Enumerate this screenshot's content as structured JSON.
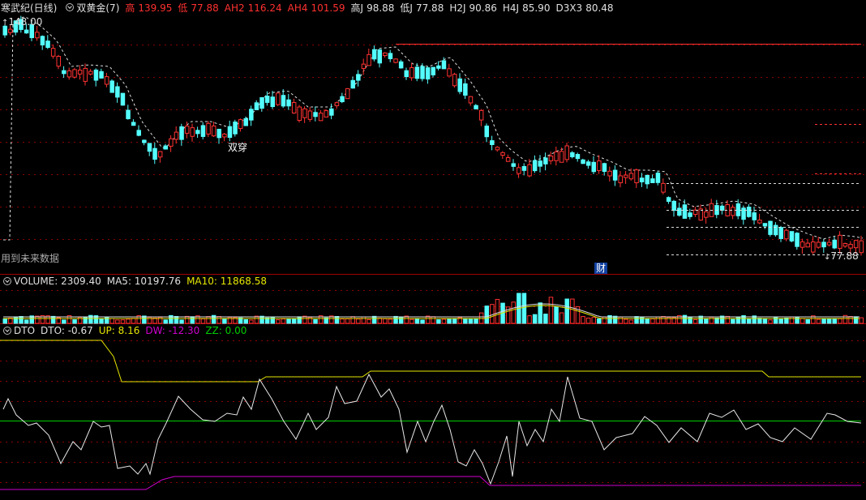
{
  "main": {
    "stock_name": "寒武纪(日线)",
    "indicator": "双黄金(7)",
    "readouts": [
      {
        "label": "高",
        "value": "139.95",
        "color": "#ff3030"
      },
      {
        "label": "低",
        "value": "77.88",
        "color": "#ff3030"
      },
      {
        "label": "AH2",
        "value": "116.24",
        "color": "#ff3030"
      },
      {
        "label": "AH4",
        "value": "101.59",
        "color": "#ff3030"
      },
      {
        "label": "高J",
        "value": "98.88",
        "color": "#e0e0e0"
      },
      {
        "label": "低J",
        "value": "77.88",
        "color": "#e0e0e0"
      },
      {
        "label": "H2J",
        "value": "90.86",
        "color": "#e0e0e0"
      },
      {
        "label": "H4J",
        "value": "85.90",
        "color": "#e0e0e0"
      },
      {
        "label": "D3X3",
        "value": "80.48",
        "color": "#e0e0e0"
      }
    ],
    "high_marker": "148.00",
    "low_marker": "77.88",
    "cross_label": "双穿",
    "future_label": "用到未来数据",
    "earnings_badge": "财"
  },
  "volume": {
    "name": "VOLUME",
    "value": "2309.40",
    "ma5_label": "MA5",
    "ma5_value": "10197.76",
    "ma10_label": "MA10",
    "ma10_value": "11868.58"
  },
  "dto": {
    "name": "DTO",
    "dto_label": "DTO",
    "dto_value": "-0.67",
    "up_label": "UP",
    "up_value": "8.16",
    "dw_label": "DW",
    "dw_value": "-12.30",
    "zz_label": "ZZ",
    "zz_value": "0.00"
  },
  "colors": {
    "up": "#ff3232",
    "down": "#54ffff",
    "ma_white": "#e8e8e8",
    "ma_yellow": "#e6e600",
    "ma_magenta": "#d000d0",
    "zz_green": "#00cc00",
    "grid": "#8b0000"
  }
}
